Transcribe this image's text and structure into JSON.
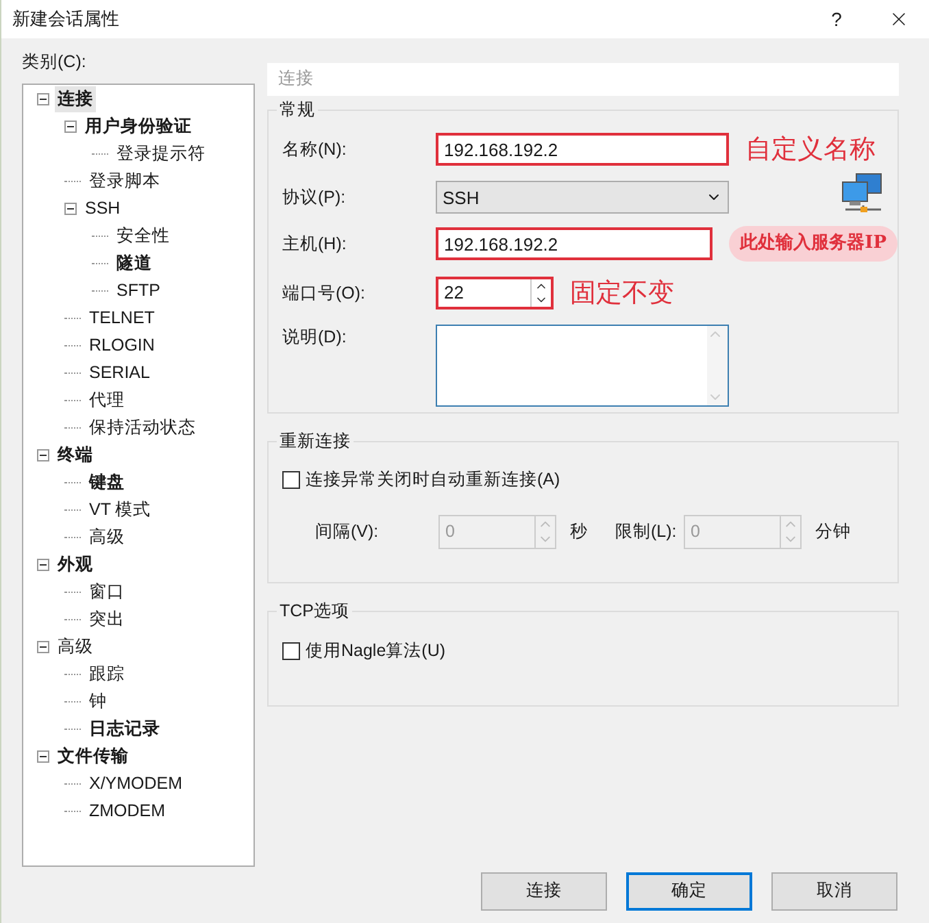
{
  "window": {
    "title": "新建会话属性",
    "help": "?"
  },
  "category_label": "类别(C):",
  "tree": [
    {
      "label": "连接",
      "bold": true,
      "selected": true,
      "expanded": true,
      "children": [
        {
          "label": "用户身份验证",
          "bold": true,
          "selected": false,
          "expanded": true,
          "children": [
            {
              "label": "登录提示符",
              "bold": false,
              "selected": false
            }
          ]
        },
        {
          "label": "登录脚本",
          "bold": false,
          "selected": false
        },
        {
          "label": "SSH",
          "bold": false,
          "selected": false,
          "expanded": true,
          "children": [
            {
              "label": "安全性",
              "bold": false,
              "selected": false
            },
            {
              "label": "隧道",
              "bold": true,
              "selected": false
            },
            {
              "label": "SFTP",
              "bold": false,
              "selected": false
            }
          ]
        },
        {
          "label": "TELNET",
          "bold": false,
          "selected": false
        },
        {
          "label": "RLOGIN",
          "bold": false,
          "selected": false
        },
        {
          "label": "SERIAL",
          "bold": false,
          "selected": false
        },
        {
          "label": "代理",
          "bold": false,
          "selected": false
        },
        {
          "label": "保持活动状态",
          "bold": false,
          "selected": false
        }
      ]
    },
    {
      "label": "终端",
      "bold": true,
      "selected": false,
      "expanded": true,
      "children": [
        {
          "label": "键盘",
          "bold": true,
          "selected": false
        },
        {
          "label": "VT 模式",
          "bold": false,
          "selected": false
        },
        {
          "label": "高级",
          "bold": false,
          "selected": false
        }
      ]
    },
    {
      "label": "外观",
      "bold": true,
      "selected": false,
      "expanded": true,
      "children": [
        {
          "label": "窗口",
          "bold": false,
          "selected": false
        },
        {
          "label": "突出",
          "bold": false,
          "selected": false
        }
      ]
    },
    {
      "label": "高级",
      "bold": false,
      "selected": false,
      "expanded": true,
      "children": [
        {
          "label": "跟踪",
          "bold": false,
          "selected": false
        },
        {
          "label": "钟",
          "bold": false,
          "selected": false
        },
        {
          "label": "日志记录",
          "bold": true,
          "selected": false
        }
      ]
    },
    {
      "label": "文件传输",
      "bold": true,
      "selected": false,
      "expanded": true,
      "children": [
        {
          "label": "X/YMODEM",
          "bold": false,
          "selected": false
        },
        {
          "label": "ZMODEM",
          "bold": false,
          "selected": false
        }
      ]
    }
  ],
  "breadcrumb": "连接",
  "general": {
    "title": "常规",
    "fields": [
      {
        "kind": "text",
        "label": "名称(N):",
        "value": "192.168.192.2",
        "highlighted": true,
        "annotation": {
          "text": "自定义名称",
          "brush": false
        }
      },
      {
        "kind": "select",
        "label": "协议(P):",
        "value": "SSH",
        "highlighted": false
      },
      {
        "kind": "text",
        "label": "主机(H):",
        "value": "192.168.192.2",
        "highlighted": true,
        "annotation": {
          "text": "此处输入服务器IP",
          "brush": true
        }
      },
      {
        "kind": "spinner",
        "label": "端口号(O):",
        "value": "22",
        "highlighted": true,
        "annotation": {
          "text": "固定不变",
          "brush": false
        }
      },
      {
        "kind": "textarea",
        "label": "说明(D):",
        "highlighted": false
      }
    ]
  },
  "reconnect": {
    "title": "重新连接",
    "checkbox": {
      "label": "连接异常关闭时自动重新连接(A)",
      "checked": false
    },
    "spinners": [
      {
        "label": "间隔(V):",
        "value": "0",
        "unit": "秒",
        "disabled": true
      },
      {
        "label": "限制(L):",
        "value": "0",
        "unit": "分钟",
        "disabled": true
      }
    ]
  },
  "tcp": {
    "title": "TCP选项",
    "checkbox": {
      "label": "使用Nagle算法(U)",
      "checked": false
    }
  },
  "buttons": [
    {
      "label": "连接",
      "default": false
    },
    {
      "label": "确定",
      "default": true
    },
    {
      "label": "取消",
      "default": false
    }
  ]
}
